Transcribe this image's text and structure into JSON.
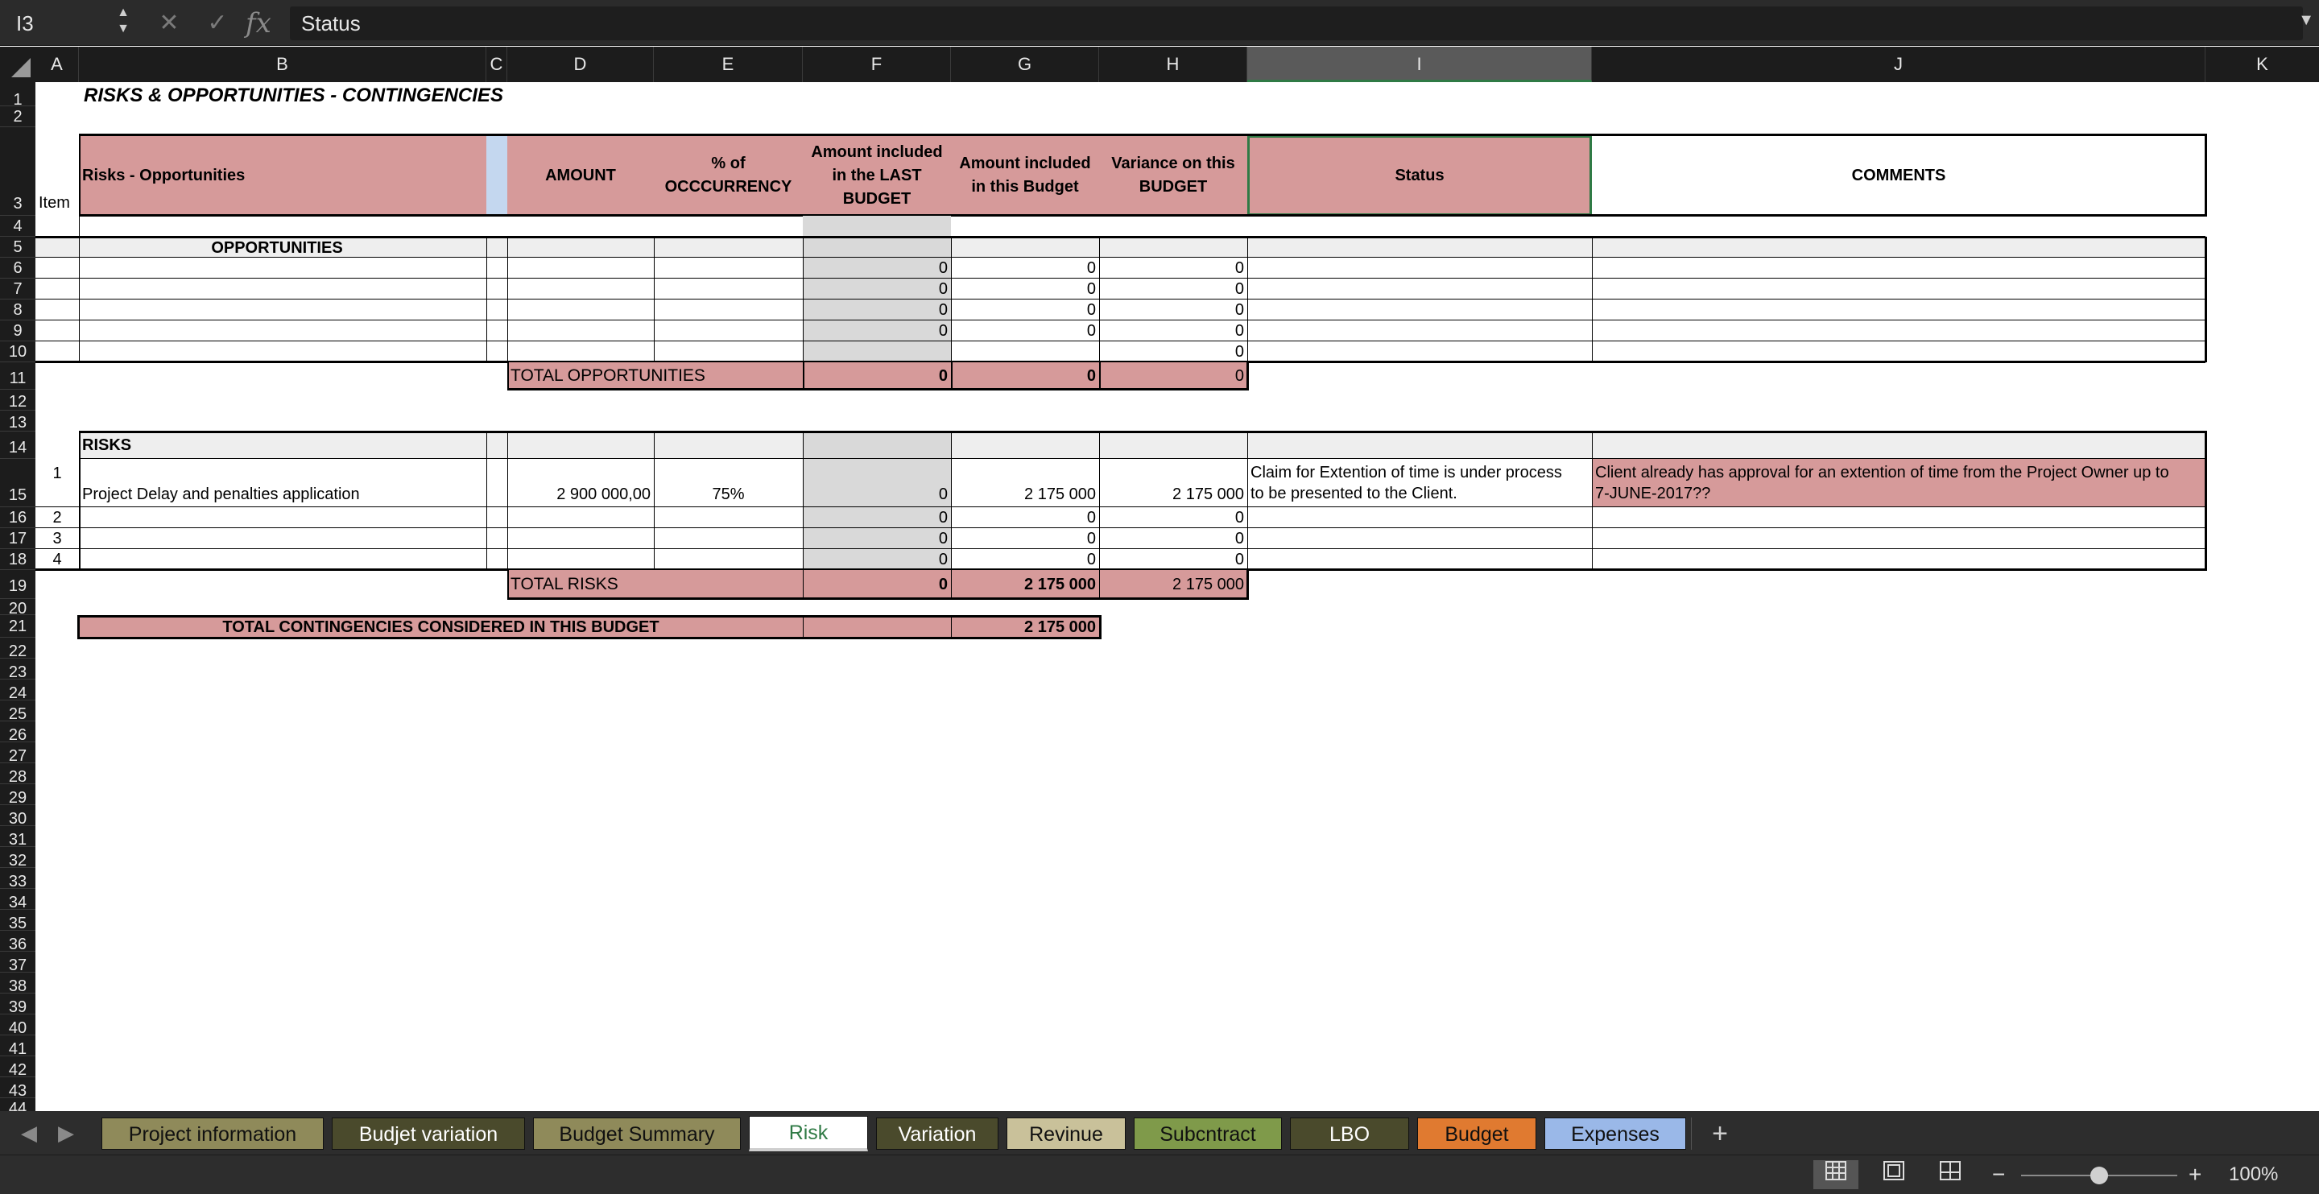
{
  "formula_bar": {
    "cell_ref": "I3",
    "content": "Status"
  },
  "columns": [
    "A",
    "B",
    "C",
    "D",
    "E",
    "F",
    "G",
    "H",
    "I",
    "J",
    "K"
  ],
  "rows": [
    "1",
    "2",
    "3",
    "4",
    "5",
    "6",
    "7",
    "8",
    "9",
    "10",
    "11",
    "12",
    "13",
    "14",
    "15",
    "16",
    "17",
    "18",
    "19",
    "20",
    "21",
    "22",
    "23",
    "24",
    "25",
    "26",
    "27",
    "28",
    "29",
    "30",
    "31",
    "32",
    "33",
    "34",
    "35",
    "36",
    "37",
    "38",
    "39",
    "40",
    "41",
    "42",
    "43",
    "44"
  ],
  "sheet": {
    "title": "RISKS & OPPORTUNITIES  - CONTINGENCIES",
    "headers": {
      "item": "Item",
      "risks_opps": "Risks - Opportunities",
      "amount": "AMOUNT",
      "occurrency": "% of OCCCURRENCY",
      "last_budget": "Amount included in the LAST BUDGET",
      "this_budget": "Amount included in this Budget",
      "variance": "Variance on this BUDGET",
      "status": "Status",
      "comments": "COMMENTS"
    },
    "opportunities_label": "OPPORTUNITIES",
    "opportunity_rows": [
      {
        "f": "0",
        "g": "0",
        "h": "0"
      },
      {
        "f": "0",
        "g": "0",
        "h": "0"
      },
      {
        "f": "0",
        "g": "0",
        "h": "0"
      },
      {
        "f": "0",
        "g": "0",
        "h": "0"
      },
      {
        "f": "",
        "g": "",
        "h": "0"
      }
    ],
    "total_opportunities": {
      "label": "TOTAL OPPORTUNITIES",
      "f": "0",
      "g": "0",
      "h": "0"
    },
    "risks_label": "RISKS",
    "risk_rows": [
      {
        "item": "1",
        "desc": "Project Delay and penalties application",
        "amount": "2 900 000,00",
        "pct": "75%",
        "f": "0",
        "g": "2 175 000",
        "h": "2 175 000",
        "status_line1": "Claim for Extention of time is under process",
        "status_line2": "to be presented to the Client.",
        "comment_line1": "Client already has approval for an extention of time from the Project Owner up to",
        "comment_line2": "7-JUNE-2017??"
      },
      {
        "item": "2",
        "f": "0",
        "g": "0",
        "h": "0"
      },
      {
        "item": "3",
        "f": "0",
        "g": "0",
        "h": "0"
      },
      {
        "item": "4",
        "f": "0",
        "g": "0",
        "h": "0"
      }
    ],
    "total_risks": {
      "label": "TOTAL RISKS",
      "f": "0",
      "g": "2 175 000",
      "h": "2 175 000"
    },
    "total_contingencies": {
      "label": "TOTAL CONTINGENCIES CONSIDERED IN THIS BUDGET",
      "g": "2 175 000"
    }
  },
  "tabs": [
    {
      "label": "Project information",
      "color": "#8f8a5a"
    },
    {
      "label": "Budjet variation",
      "color": "#4a4a2c"
    },
    {
      "label": "Budget Summary",
      "color": "#8f8a5a"
    },
    {
      "label": "Risk",
      "color": "#ffffff",
      "active": true
    },
    {
      "label": "Variation",
      "color": "#4a4a2c"
    },
    {
      "label": "Revinue",
      "color": "#c9c19a"
    },
    {
      "label": "Subcntract",
      "color": "#7f9a4a"
    },
    {
      "label": "LBO",
      "color": "#4a4a2c"
    },
    {
      "label": "Budget",
      "color": "#e07a30"
    },
    {
      "label": "Expenses",
      "color": "#9ab8e8"
    }
  ],
  "status_bar": {
    "zoom": "100%"
  },
  "colors": {
    "accent": "#2f7a45",
    "header_pink": "#d69a9a",
    "grey_cell": "#d9d9d9"
  }
}
